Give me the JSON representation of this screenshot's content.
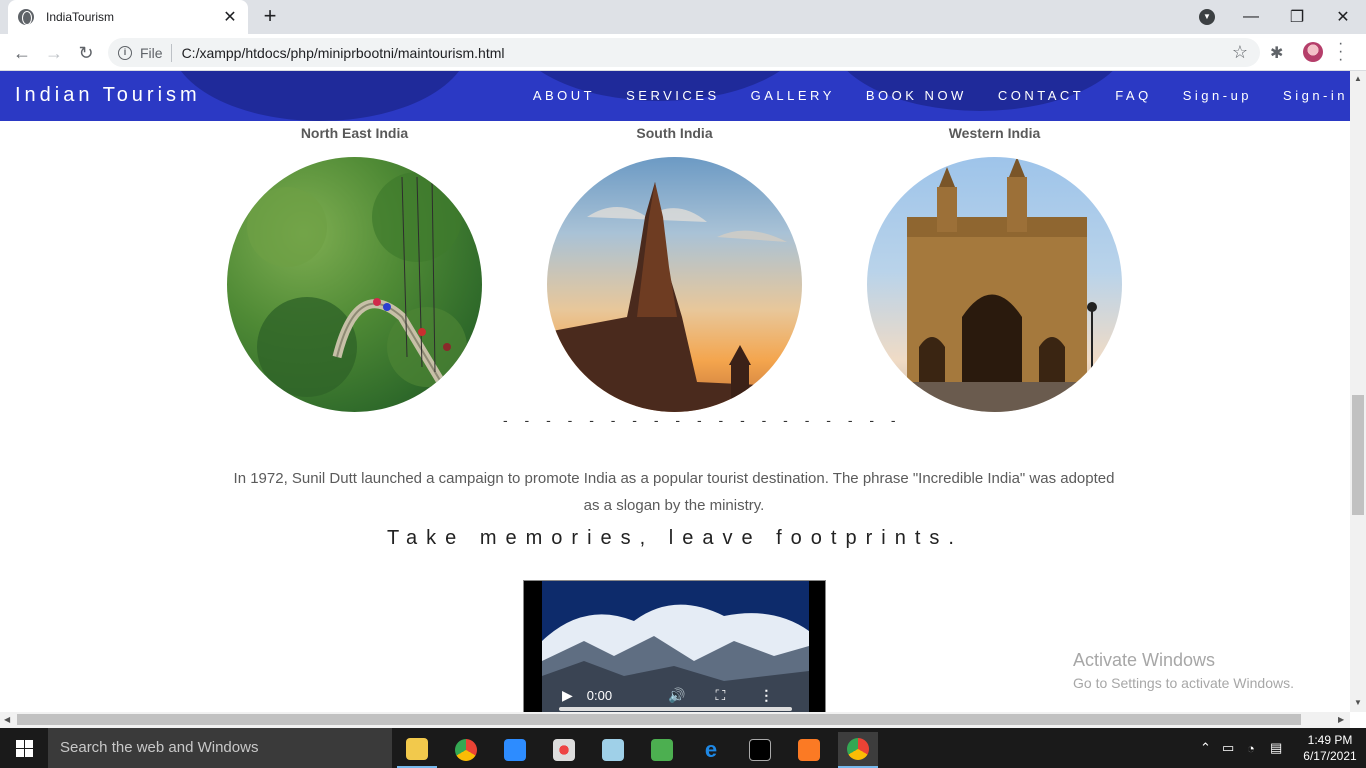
{
  "browser": {
    "tab_title": "IndiaTourism",
    "new_tab_label": "+",
    "close_tab_label": "✕",
    "file_label": "File",
    "url": "C:/xampp/htdocs/php/miniprbootni/maintourism.html"
  },
  "site": {
    "brand": "Indian Tourism",
    "nav": [
      "ABOUT",
      "SERVICES",
      "GALLERY",
      "BOOK NOW",
      "CONTACT",
      "FAQ",
      "Sign-up",
      "Sign-in"
    ]
  },
  "regions": [
    {
      "title": "North East India"
    },
    {
      "title": "South India"
    },
    {
      "title": "Western India"
    }
  ],
  "divider": "- - - - - - - - - - - - - - - - - - -",
  "paragraph": "In 1972, Sunil Dutt launched a campaign to promote India as a popular tourist destination. The phrase \"Incredible India\" was adopted as a slogan by the ministry.",
  "tagline": "Take memories, leave footprints.",
  "video": {
    "time": "0:00"
  },
  "watermark": {
    "line1": "Activate Windows",
    "line2": "Go to Settings to activate Windows."
  },
  "taskbar": {
    "search_placeholder": "Search the web and Windows",
    "time": "1:49 PM",
    "date": "6/17/2021"
  },
  "colors": {
    "navbar": "#2b39c4",
    "taskbar": "#1a1a1a"
  }
}
